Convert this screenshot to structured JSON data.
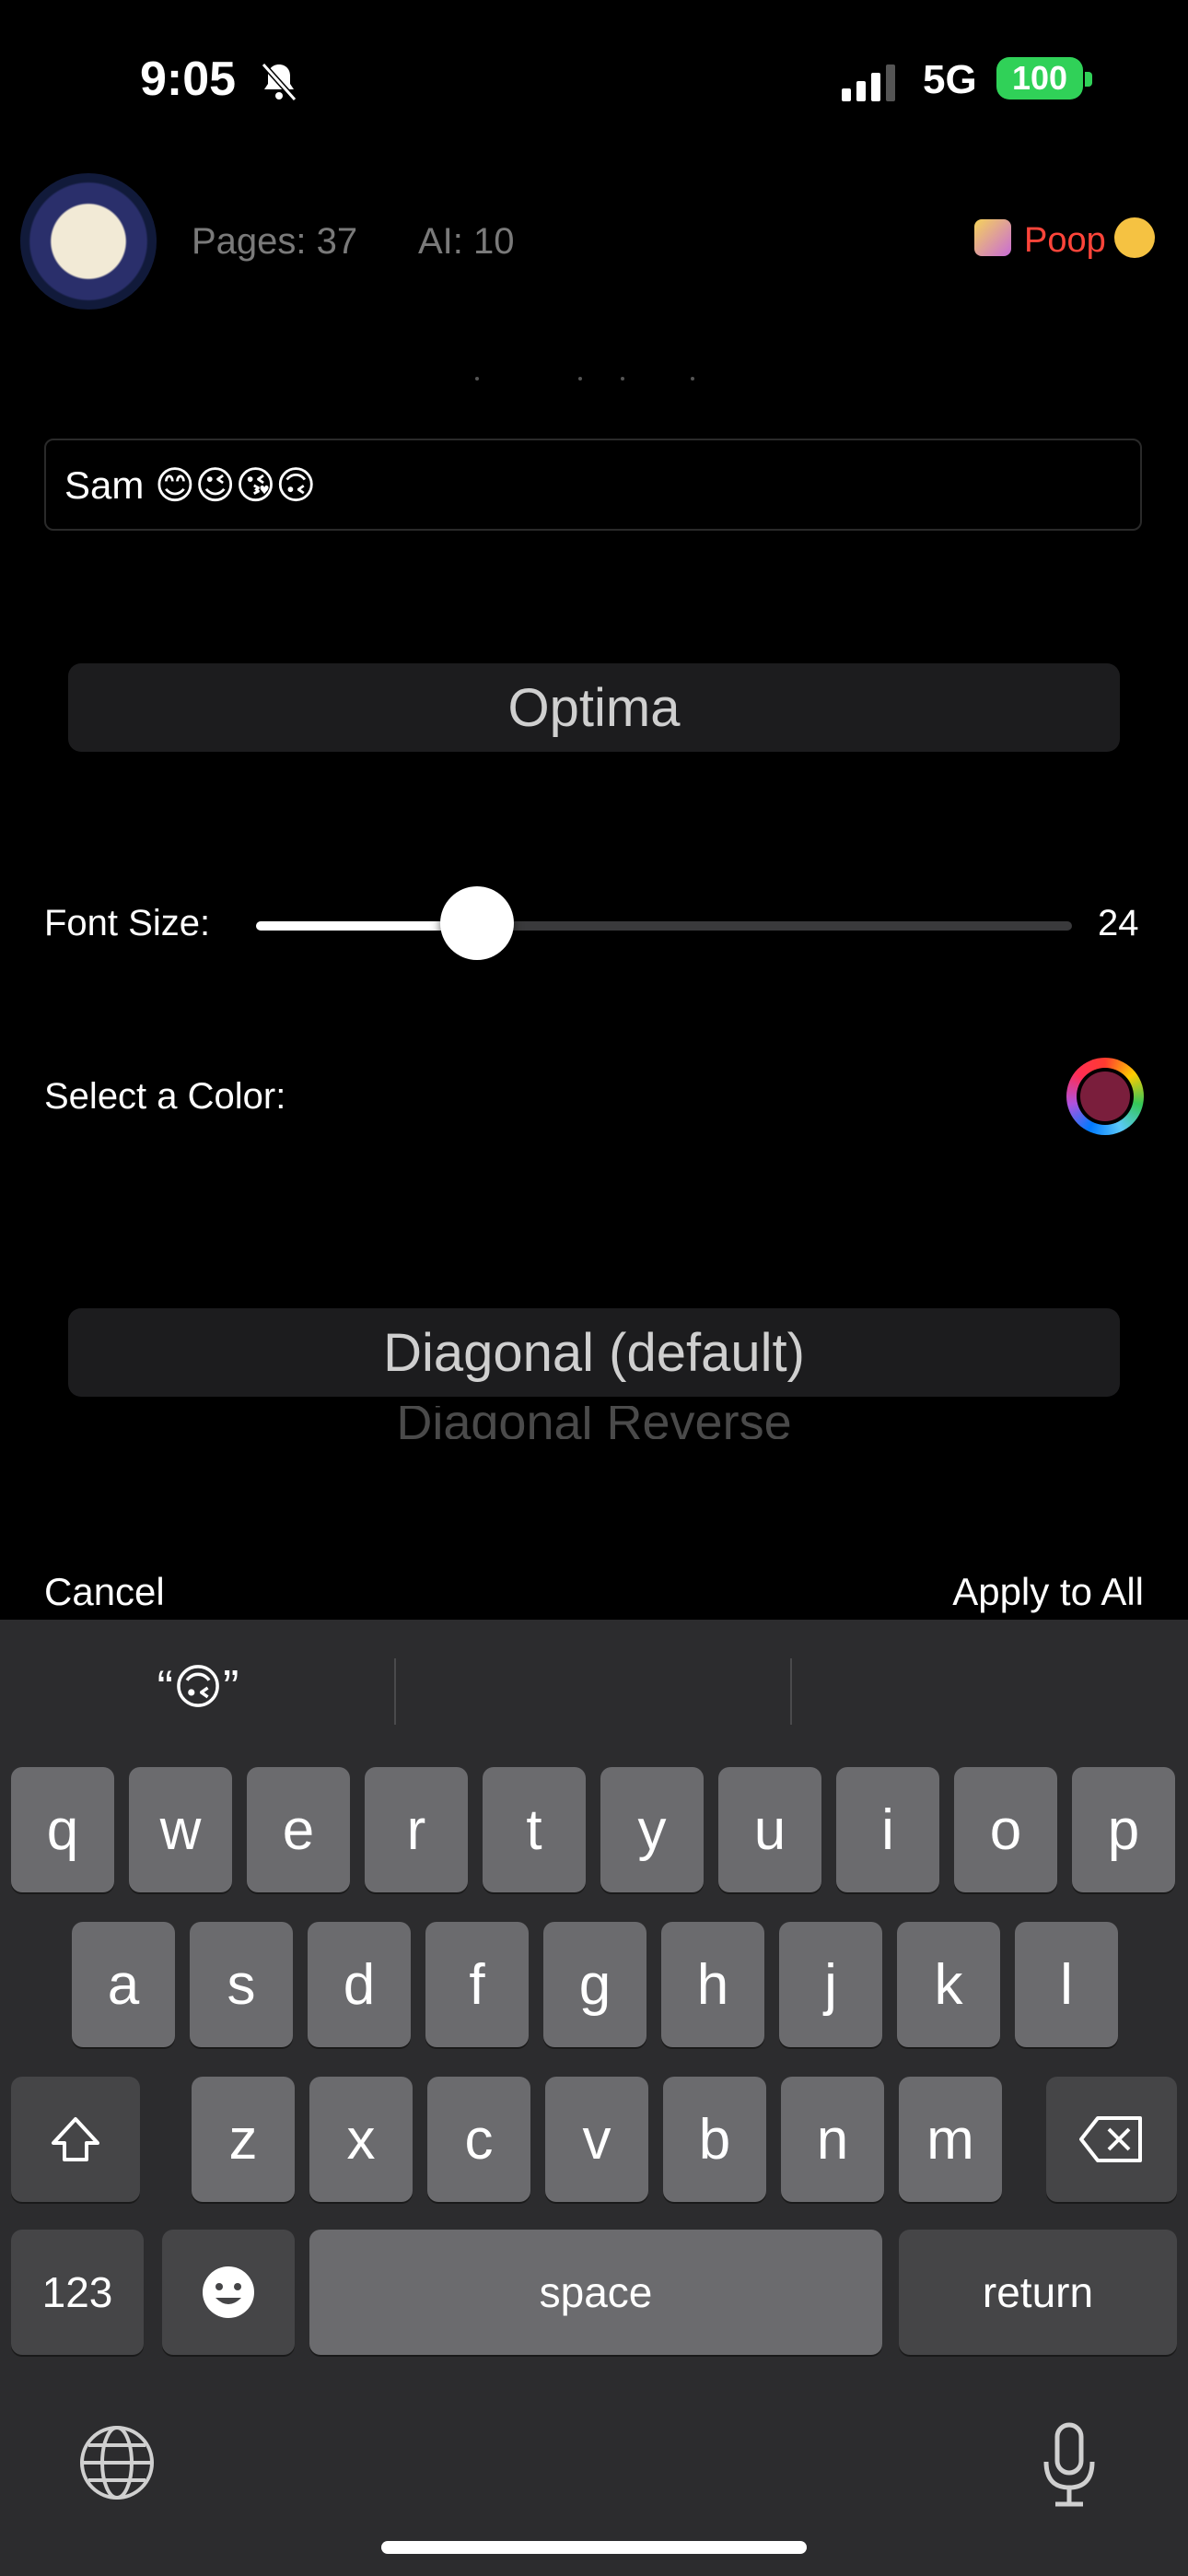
{
  "status_bar": {
    "time": "9:05",
    "network": "5G",
    "battery": "100",
    "icons": [
      "bell-slash-icon",
      "signal-icon"
    ]
  },
  "header": {
    "pages": "Pages: 37",
    "ai": "AI: 10",
    "user_name": "Poop"
  },
  "text_input": {
    "value": "Sam 😊😉😘🙃"
  },
  "font_picker": {
    "selected": "Optima"
  },
  "font_size": {
    "label": "Font Size:",
    "value": "24",
    "level_fraction": 0.26
  },
  "color": {
    "label": "Select a Color:",
    "selected": "#7a1e3c"
  },
  "direction_picker": {
    "selected": "Diagonal (default)",
    "next": "Diagonal Reverse"
  },
  "actions": {
    "cancel": "Cancel",
    "apply_all": "Apply to All"
  },
  "keyboard": {
    "suggestion": "“🙃”",
    "row1": [
      "q",
      "w",
      "e",
      "r",
      "t",
      "y",
      "u",
      "i",
      "o",
      "p"
    ],
    "row2": [
      "a",
      "s",
      "d",
      "f",
      "g",
      "h",
      "j",
      "k",
      "l"
    ],
    "row3": [
      "z",
      "x",
      "c",
      "v",
      "b",
      "n",
      "m"
    ],
    "numbers": "123",
    "space": "space",
    "return": "return"
  }
}
